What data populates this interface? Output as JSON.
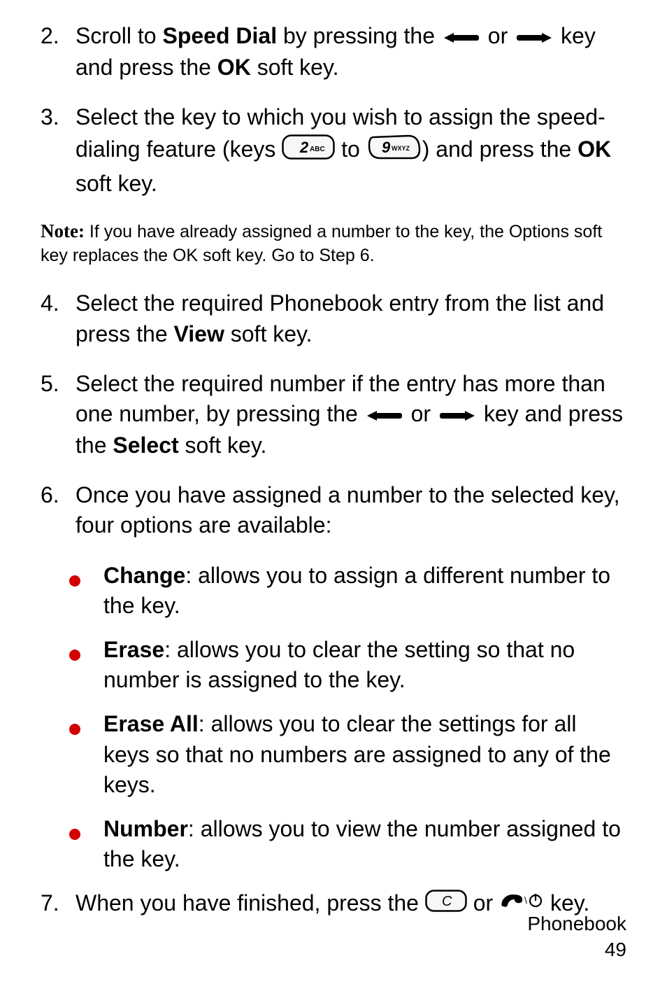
{
  "steps": {
    "s2": {
      "num": "2.",
      "pre": "Scroll to ",
      "bold1": "Speed Dial",
      "mid1": " by pressing the ",
      "mid2": " or ",
      "mid3": " key and press the ",
      "bold2": "OK",
      "post": " soft key."
    },
    "s3": {
      "num": "3.",
      "pre": "Select the key to which you wish to assign the speed-dialing feature (keys ",
      "mid1": " to ",
      "mid2": ") and press the ",
      "bold1": "OK",
      "post": " soft key."
    },
    "s4": {
      "num": "4.",
      "pre": "Select the required Phonebook entry from the list and press the ",
      "bold1": "View",
      "post": " soft key."
    },
    "s5": {
      "num": "5.",
      "pre": "Select the required number if the entry has more than one number, by pressing the ",
      "mid1": " or ",
      "mid2": " key and press the ",
      "bold1": "Select",
      "post": " soft key."
    },
    "s6": {
      "num": "6.",
      "text": "Once you have assigned a number to the selected key, four options are available:"
    },
    "s7": {
      "num": "7.",
      "pre": "When you have finished, press the ",
      "mid1": " or ",
      "post": " key."
    }
  },
  "note": {
    "label": "Note:",
    "text": " If you have already assigned a number to the key, the Options soft key replaces the OK soft key. Go to Step 6."
  },
  "bullets": {
    "b1": {
      "bold": "Change",
      "text": ": allows you to assign a different number to the key."
    },
    "b2": {
      "bold": "Erase",
      "text": ": allows you to clear the setting so that no number is assigned to the key."
    },
    "b3": {
      "bold": "Erase All",
      "text": ": allows you to clear the settings for all keys so that no numbers are assigned to any of the keys."
    },
    "b4": {
      "bold": "Number",
      "text": ": allows you to view the number assigned to the key."
    }
  },
  "key_labels": {
    "two": "2",
    "two_sub": "ABC",
    "nine": "9",
    "nine_sub": "WXYZ",
    "c": "C"
  },
  "footer": {
    "section": "Phonebook",
    "page": "49"
  },
  "icon_names": {
    "left_soft": "left-softkey-icon",
    "right_soft": "right-softkey-icon",
    "key2": "keypad-2-icon",
    "key9": "keypad-9-icon",
    "keyC": "keypad-c-icon",
    "end": "end-call-power-icon",
    "bullet": "bullet-dot-icon"
  }
}
